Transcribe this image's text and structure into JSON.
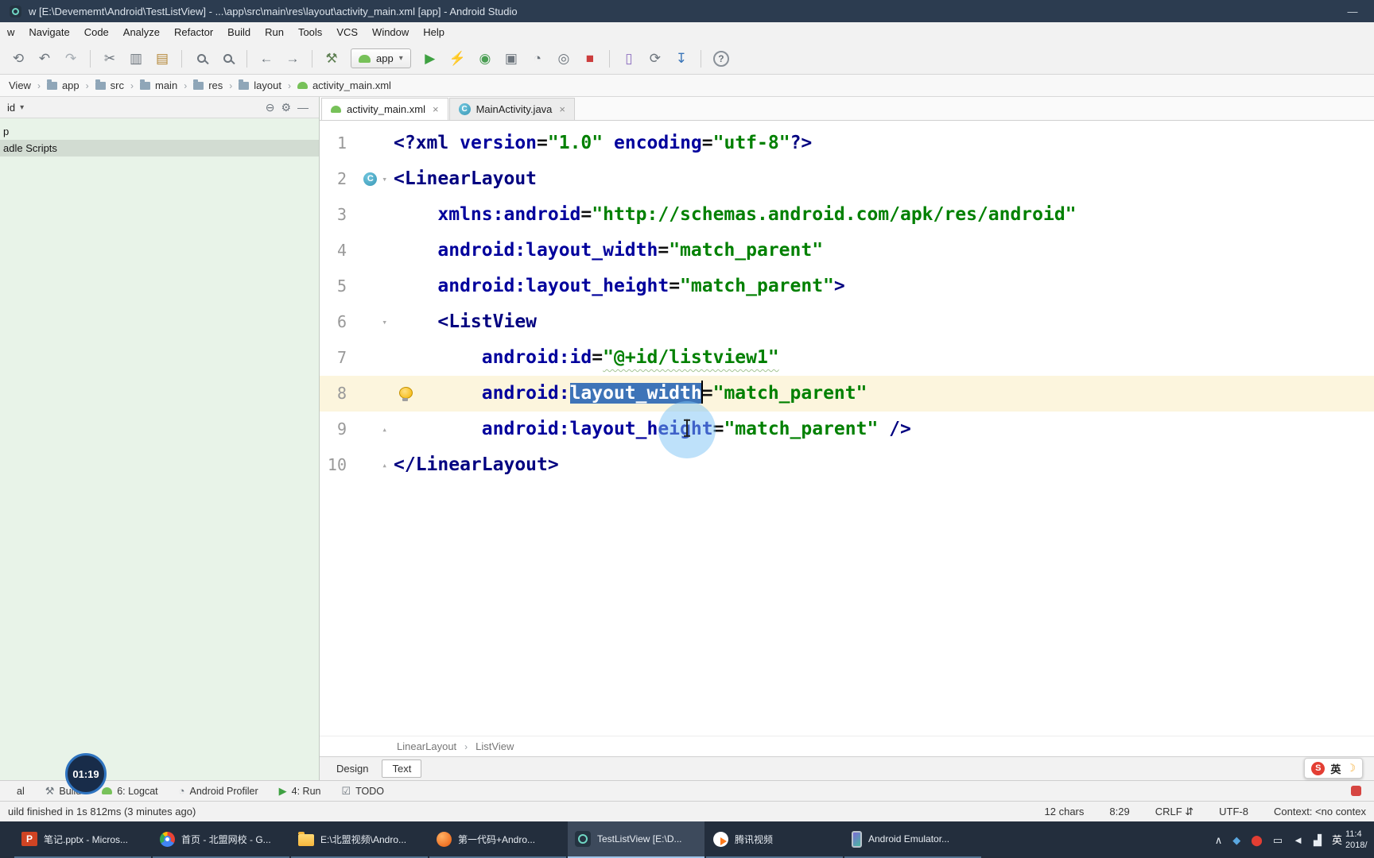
{
  "colors": {
    "titlebar": "#2c3c50",
    "panel": "#e8f3e8",
    "selection": "#3e74b8",
    "caretrow": "#fcf5dd",
    "tag": "#000080",
    "attr": "#00009c",
    "value": "#008000",
    "taskbar": "#232e3d"
  },
  "window": {
    "title": "w [E:\\Devememt\\Android\\TestListView] - ...\\app\\src\\main\\res\\layout\\activity_main.xml [app] - Android Studio",
    "minimize_glyph": "—"
  },
  "menu_items": [
    "w",
    "Navigate",
    "Code",
    "Analyze",
    "Refactor",
    "Build",
    "Run",
    "Tools",
    "VCS",
    "Window",
    "Help"
  ],
  "toolbar_items": [
    {
      "type": "icon",
      "name": "sync-icon",
      "glyph": "⟲",
      "color": "#6d757d"
    },
    {
      "type": "icon",
      "name": "undo-icon",
      "glyph": "↶",
      "color": "#6d757d"
    },
    {
      "type": "icon",
      "name": "redo-icon",
      "glyph": "↷",
      "color": "#a6adb3"
    },
    {
      "type": "sep"
    },
    {
      "type": "icon",
      "name": "cut-icon",
      "glyph": "✂",
      "color": "#6d757d"
    },
    {
      "type": "icon",
      "name": "copy-icon",
      "glyph": "▥",
      "color": "#6d757d"
    },
    {
      "type": "icon",
      "name": "paste-icon",
      "glyph": "▤",
      "color": "#b5893a"
    },
    {
      "type": "sep"
    },
    {
      "type": "magnifier",
      "name": "find-icon"
    },
    {
      "type": "magnifier",
      "name": "replace-icon"
    },
    {
      "type": "sep"
    },
    {
      "type": "icon",
      "name": "back-icon",
      "glyph": "←",
      "color": "#6d757d"
    },
    {
      "type": "icon",
      "name": "forward-icon",
      "glyph": "→",
      "color": "#6d757d"
    },
    {
      "type": "sep"
    },
    {
      "type": "icon",
      "name": "make-project-hammer-icon",
      "glyph": "⚒",
      "color": "#5e7f52"
    },
    {
      "type": "run-config",
      "name": "run-config-dropdown",
      "label": "app"
    },
    {
      "type": "icon",
      "name": "run-icon",
      "glyph": "▶",
      "color": "#3fa142"
    },
    {
      "type": "icon",
      "name": "apply-changes-icon",
      "glyph": "⚡",
      "color": "#d9a321"
    },
    {
      "type": "icon",
      "name": "debug-icon",
      "glyph": "◉",
      "color": "#4a9e53"
    },
    {
      "type": "icon",
      "name": "coverage-icon",
      "glyph": "▣",
      "color": "#6d757d"
    },
    {
      "type": "icon",
      "name": "profiler-icon",
      "glyph": "◔",
      "color": "#6d757d"
    },
    {
      "type": "icon",
      "name": "attach-debugger-icon",
      "glyph": "◎",
      "color": "#6d757d"
    },
    {
      "type": "icon",
      "name": "stop-icon",
      "glyph": "■",
      "color": "#cc3d3d"
    },
    {
      "type": "sep"
    },
    {
      "type": "icon",
      "name": "avd-manager-icon",
      "glyph": "▯",
      "color": "#8e6fc0"
    },
    {
      "type": "icon",
      "name": "gradle-sync-icon",
      "glyph": "⟳",
      "color": "#6d757d"
    },
    {
      "type": "icon",
      "name": "sdk-manager-icon",
      "glyph": "↧",
      "color": "#3874b8"
    },
    {
      "type": "sep"
    },
    {
      "type": "icon",
      "name": "help-icon",
      "glyph": "?",
      "color": "#6d757d",
      "circle": true
    }
  ],
  "navbar": {
    "separator": "›",
    "items": [
      {
        "label": "View",
        "icon": "none"
      },
      {
        "label": "app",
        "icon": "folder"
      },
      {
        "label": "src",
        "icon": "folder"
      },
      {
        "label": "main",
        "icon": "folder"
      },
      {
        "label": "res",
        "icon": "folder"
      },
      {
        "label": "layout",
        "icon": "folder"
      },
      {
        "label": "activity_main.xml",
        "icon": "android-file"
      }
    ]
  },
  "project_panel": {
    "header": {
      "label": "id",
      "caret": "▾",
      "icons": [
        {
          "name": "collapse-all-icon",
          "glyph": "⊖"
        },
        {
          "name": "settings-gear-icon",
          "glyph": "⚙"
        },
        {
          "name": "hide-panel-icon",
          "glyph": "—"
        }
      ]
    },
    "rows": [
      {
        "label": "p",
        "selected": false
      },
      {
        "label": "adle Scripts",
        "selected": true
      }
    ]
  },
  "editor": {
    "tabs": [
      {
        "label": "activity_main.xml",
        "icon": "android-file",
        "close": "×",
        "active": true
      },
      {
        "label": "MainActivity.java",
        "icon": "class",
        "close": "×",
        "active": false
      }
    ],
    "class_icon_letter": "C",
    "lines": [
      {
        "num": "1",
        "tokens": [
          {
            "t": "<?xml ",
            "s": "tag"
          },
          {
            "t": "version",
            "s": "attr"
          },
          {
            "t": "=",
            "s": "plain"
          },
          {
            "t": "\"1.0\"",
            "s": "val"
          },
          {
            "t": " ",
            "s": "plain"
          },
          {
            "t": "encoding",
            "s": "attr"
          },
          {
            "t": "=",
            "s": "plain"
          },
          {
            "t": "\"utf-8\"",
            "s": "val"
          },
          {
            "t": "?>",
            "s": "tag"
          }
        ]
      },
      {
        "num": "2",
        "gutter_icon": "class",
        "fold": "▾",
        "tokens": [
          {
            "t": "<LinearLayout",
            "s": "tag"
          }
        ]
      },
      {
        "num": "3",
        "tokens": [
          {
            "t": "    ",
            "s": "plain"
          },
          {
            "t": "xmlns:android",
            "s": "attr"
          },
          {
            "t": "=",
            "s": "plain"
          },
          {
            "t": "\"http://schemas.android.com/apk/res/android\"",
            "s": "val"
          }
        ]
      },
      {
        "num": "4",
        "tokens": [
          {
            "t": "    ",
            "s": "plain"
          },
          {
            "t": "android:layout_width",
            "s": "attr"
          },
          {
            "t": "=",
            "s": "plain"
          },
          {
            "t": "\"match_parent\"",
            "s": "val"
          }
        ]
      },
      {
        "num": "5",
        "tokens": [
          {
            "t": "    ",
            "s": "plain"
          },
          {
            "t": "android:layout_height",
            "s": "attr"
          },
          {
            "t": "=",
            "s": "plain"
          },
          {
            "t": "\"match_parent\"",
            "s": "val"
          },
          {
            "t": ">",
            "s": "tag"
          }
        ]
      },
      {
        "num": "6",
        "fold": "▾",
        "tokens": [
          {
            "t": "    ",
            "s": "plain"
          },
          {
            "t": "<ListView",
            "s": "tag"
          }
        ]
      },
      {
        "num": "7",
        "tokens": [
          {
            "t": "        ",
            "s": "plain"
          },
          {
            "t": "android:id",
            "s": "attr"
          },
          {
            "t": "=",
            "s": "plain"
          },
          {
            "t": "\"@+id/listview1\"",
            "s": "valtypo"
          }
        ]
      },
      {
        "num": "8",
        "caret_row": true,
        "gutter_icon": "bulb",
        "tokens": [
          {
            "t": "        ",
            "s": "plain"
          },
          {
            "t": "android:",
            "s": "attr"
          },
          {
            "t": "layout_width",
            "s": "attrsel",
            "caret_after": true
          },
          {
            "t": "=",
            "s": "plain"
          },
          {
            "t": "\"match_parent\"",
            "s": "val"
          }
        ]
      },
      {
        "num": "9",
        "fold": "▴",
        "tokens": [
          {
            "t": "        ",
            "s": "plain"
          },
          {
            "t": "android:layout_height",
            "s": "attr"
          },
          {
            "t": "=",
            "s": "plain"
          },
          {
            "t": "\"match_parent\"",
            "s": "val"
          },
          {
            "t": " />",
            "s": "tag"
          }
        ]
      },
      {
        "num": "10",
        "fold": "▴",
        "tokens": [
          {
            "t": "</LinearLayout>",
            "s": "tag"
          }
        ]
      }
    ],
    "xml_breadcrumb": {
      "separator": "›",
      "items": [
        "LinearLayout",
        "ListView"
      ]
    },
    "bottom_tabs": [
      {
        "label": "Design",
        "active": false
      },
      {
        "label": "Text",
        "active": true
      }
    ]
  },
  "toolwindow_bar": {
    "items": [
      {
        "label": "al",
        "icon": "none"
      },
      {
        "label": "Build",
        "icon": "hammer"
      },
      {
        "label": "6: Logcat",
        "icon": "android-head"
      },
      {
        "label": "Android Profiler",
        "icon": "gauge"
      },
      {
        "label": "4: Run",
        "icon": "run"
      },
      {
        "label": "TODO",
        "icon": "todo"
      }
    ]
  },
  "statusbar": {
    "message": "uild finished in 1s 812ms (3 minutes ago)",
    "items": [
      "12 chars",
      "8:29",
      "CRLF ⇵",
      "UTF-8",
      "Context: <no contex"
    ]
  },
  "recorder": {
    "time": "01:19"
  },
  "sogou": {
    "letter": "S",
    "lang": "英",
    "moon": "☽"
  },
  "taskbar": {
    "apps": [
      {
        "label": "笔记.pptx - Micros...",
        "icon": "powerpoint",
        "active": false
      },
      {
        "label": "首页 - 北盟网校 - G...",
        "icon": "chrome",
        "active": false
      },
      {
        "label": "E:\\北盟视频\\Andro...",
        "icon": "folder",
        "active": false
      },
      {
        "label": "第一代码+Andro...",
        "icon": "browser",
        "active": false
      },
      {
        "label": "TestListView [E:\\D...",
        "icon": "android-studio",
        "active": true
      },
      {
        "label": "腾讯视频",
        "icon": "tencent-video",
        "active": false
      },
      {
        "label": "Android Emulator...",
        "icon": "emulator",
        "active": false
      }
    ],
    "tray": [
      {
        "name": "tray-expand-icon",
        "glyph": "∧",
        "color": "#e8edf3"
      },
      {
        "name": "security-shield-icon",
        "glyph": "◆",
        "color": "#5aa7e0"
      },
      {
        "name": "sogou-tray-icon",
        "glyph": "⬤",
        "color": "#e33e33"
      },
      {
        "name": "display-icon",
        "glyph": "▭",
        "color": "#e8edf3"
      },
      {
        "name": "volume-icon",
        "glyph": "◄",
        "color": "#e8edf3"
      },
      {
        "name": "network-icon",
        "glyph": "▟",
        "color": "#e8edf3"
      },
      {
        "name": "ime-indicator",
        "glyph": "英",
        "color": "#ffffff"
      }
    ],
    "clock": {
      "time": "11:4",
      "date": "2018/"
    }
  }
}
